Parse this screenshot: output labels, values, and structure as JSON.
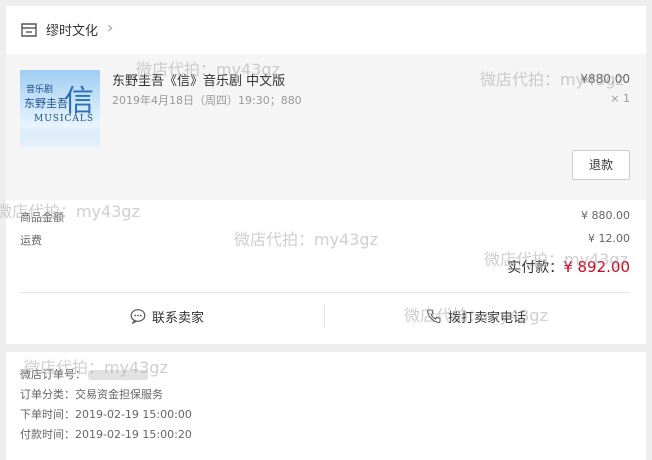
{
  "shop": {
    "name": "缪时文化",
    "chevron": "›"
  },
  "item": {
    "cover_line1": "音乐剧",
    "cover_line2": "东野圭吾",
    "cover_big": "信",
    "cover_line3": "MUSICALS",
    "title": "东野圭吾《信》音乐剧 中文版",
    "subtitle": "2019年4月18日（周四）19:30；880",
    "price": "¥880.00",
    "quantity": "× 1",
    "refund_label": "退款"
  },
  "summary": {
    "goods_label": "商品金额",
    "goods_value": "¥ 880.00",
    "shipping_label": "运费",
    "shipping_value": "¥ 12.00",
    "paid_label": "实付款：",
    "paid_value": "¥ 892.00"
  },
  "actions": {
    "contact_label": "联系卖家",
    "call_label": "拨打卖家电话"
  },
  "order_info": {
    "order_no_label": "微店订单号：",
    "category": "订单分类：交易资金担保服务",
    "order_time": "下单时间：2019-02-19 15:00:00",
    "pay_time": "付款时间：2019-02-19 15:00:20"
  },
  "watermark": "微店代拍：my43gz",
  "colors": {
    "accent_price": "#d0021b",
    "background": "#eeeeee"
  }
}
